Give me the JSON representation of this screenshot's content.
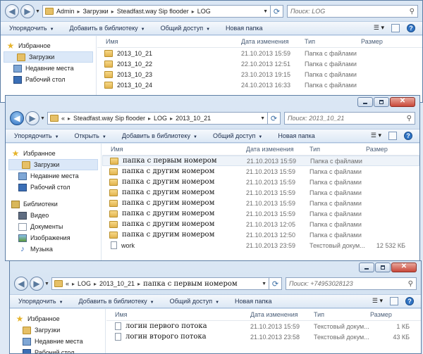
{
  "windows": [
    {
      "path": [
        "Admin",
        "Загрузки",
        "Steadfast.way Sip flooder",
        "LOG"
      ],
      "search_placeholder": "Поиск: LOG",
      "commands": [
        "Упорядочить",
        "Добавить в библиотеку",
        "Общий доступ",
        "Новая папка"
      ],
      "sidebar": [
        {
          "label": "Избранное",
          "icon": "star-icon",
          "top": true
        },
        {
          "label": "Загрузки",
          "icon": "downloads-folder-icon",
          "selected": true
        },
        {
          "label": "Недавние места",
          "icon": "recent-places-icon"
        },
        {
          "label": "Рабочий стол",
          "icon": "desktop-icon"
        }
      ],
      "columns": [
        "Имя",
        "Дата изменения",
        "Тип",
        "Размер"
      ],
      "rows": [
        {
          "name": "2013_10_21",
          "date": "21.10.2013 15:59",
          "type": "Папка с файлами",
          "size": "",
          "kind": "folder"
        },
        {
          "name": "2013_10_22",
          "date": "22.10.2013 12:51",
          "type": "Папка с файлами",
          "size": "",
          "kind": "folder"
        },
        {
          "name": "2013_10_23",
          "date": "23.10.2013 19:15",
          "type": "Папка с файлами",
          "size": "",
          "kind": "folder"
        },
        {
          "name": "2013_10_24",
          "date": "24.10.2013 16:33",
          "type": "Папка с файлами",
          "size": "",
          "kind": "folder"
        }
      ]
    },
    {
      "path": [
        "«",
        "Steadfast.way Sip flooder",
        "LOG",
        "2013_10_21"
      ],
      "search_placeholder": "Поиск: 2013_10_21",
      "commands": [
        "Упорядочить",
        "Открыть",
        "Добавить в библиотеку",
        "Общий доступ",
        "Новая папка"
      ],
      "sidebar": [
        {
          "label": "Избранное",
          "icon": "star-icon",
          "top": true
        },
        {
          "label": "Загрузки",
          "icon": "downloads-folder-icon",
          "selected": true
        },
        {
          "label": "Недавние места",
          "icon": "recent-places-icon"
        },
        {
          "label": "Рабочий стол",
          "icon": "desktop-icon"
        },
        {
          "gap": true
        },
        {
          "label": "Библиотеки",
          "icon": "libraries-icon",
          "top": true
        },
        {
          "label": "Видео",
          "icon": "video-icon"
        },
        {
          "label": "Документы",
          "icon": "documents-icon"
        },
        {
          "label": "Изображения",
          "icon": "images-icon"
        },
        {
          "label": "Музыка",
          "icon": "music-icon"
        }
      ],
      "columns": [
        "Имя",
        "Дата изменения",
        "Тип",
        "Размер"
      ],
      "rows": [
        {
          "name": "папка с первым номером",
          "date": "21.10.2013 15:59",
          "type": "Папка с файлами",
          "size": "",
          "kind": "folder",
          "selected": true,
          "serif": true
        },
        {
          "name": "папка с другим номером",
          "date": "21.10.2013 15:59",
          "type": "Папка с файлами",
          "size": "",
          "kind": "folder",
          "serif": true
        },
        {
          "name": "папка с другим номером",
          "date": "21.10.2013 15:59",
          "type": "Папка с файлами",
          "size": "",
          "kind": "folder",
          "serif": true
        },
        {
          "name": "папка с другим номером",
          "date": "21.10.2013 15:59",
          "type": "Папка с файлами",
          "size": "",
          "kind": "folder",
          "serif": true
        },
        {
          "name": "папка с другим номером",
          "date": "21.10.2013 15:59",
          "type": "Папка с файлами",
          "size": "",
          "kind": "folder",
          "serif": true
        },
        {
          "name": "папка с другим номером",
          "date": "21.10.2013 15:59",
          "type": "Папка с файлами",
          "size": "",
          "kind": "folder",
          "serif": true
        },
        {
          "name": "папка с другим номером",
          "date": "21.10.2013 12:05",
          "type": "Папка с файлами",
          "size": "",
          "kind": "folder",
          "serif": true
        },
        {
          "name": "папка с другим номером",
          "date": "21.10.2013 12:50",
          "type": "Папка с файлами",
          "size": "",
          "kind": "folder",
          "serif": true
        },
        {
          "name": "work",
          "date": "21.10.2013 23:59",
          "type": "Текстовый докум...",
          "size": "12 532 КБ",
          "kind": "file"
        }
      ]
    },
    {
      "path": [
        "«",
        "LOG",
        "2013_10_21",
        "папка с первым номером"
      ],
      "search_placeholder": "Поиск: +74953028123",
      "commands": [
        "Упорядочить",
        "Добавить в библиотеку",
        "Общий доступ",
        "Новая папка"
      ],
      "sidebar": [
        {
          "label": "Избранное",
          "icon": "star-icon",
          "top": true
        },
        {
          "label": "Загрузки",
          "icon": "downloads-folder-icon"
        },
        {
          "label": "Недавние места",
          "icon": "recent-places-icon"
        },
        {
          "label": "Рабочий стол",
          "icon": "desktop-icon"
        }
      ],
      "columns": [
        "Имя",
        "Дата изменения",
        "Тип",
        "Размер"
      ],
      "rows": [
        {
          "name": "логин первого потока",
          "date": "21.10.2013 15:59",
          "type": "Текстовый докум...",
          "size": "1 КБ",
          "kind": "file",
          "serif": true
        },
        {
          "name": "логин второго потока",
          "date": "21.10.2013 23:58",
          "type": "Текстовый докум...",
          "size": "43 КБ",
          "kind": "file",
          "serif": true
        }
      ]
    }
  ]
}
